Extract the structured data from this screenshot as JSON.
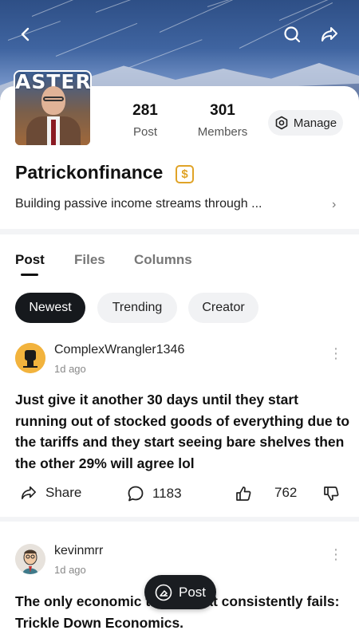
{
  "header": {
    "back_icon": "back-chevron-icon",
    "search_icon": "search-icon",
    "share_icon": "share-arrow-icon"
  },
  "profile": {
    "avatar_brand": "ASTER",
    "post_count": "281",
    "post_label": "Post",
    "member_count": "301",
    "member_label": "Members",
    "manage_label": "Manage",
    "name": "Patrickonfinance",
    "badge": "$",
    "bio": "Building passive income streams through ...",
    "bio_chevron": "›"
  },
  "tabs": [
    {
      "label": "Post",
      "active": true
    },
    {
      "label": "Files",
      "active": false
    },
    {
      "label": "Columns",
      "active": false
    }
  ],
  "filters": [
    {
      "label": "Newest",
      "active": true
    },
    {
      "label": "Trending",
      "active": false
    },
    {
      "label": "Creator",
      "active": false
    }
  ],
  "posts": [
    {
      "username": "ComplexWrangler1346",
      "time": "1d ago",
      "text": "Just give it another 30 days until they start running out of stocked goods of everything due to the tariffs and they start seeing bare shelves then the other 29% will agree lol",
      "share_label": "Share",
      "comments": "1183",
      "likes": "762"
    },
    {
      "username": "kevinmrr",
      "time": "1d ago",
      "text": "The only economic theory that consistently fails: Trickle Down Economics."
    }
  ],
  "fab": {
    "label": "Post"
  },
  "colors": {
    "accent_dark": "#16191d",
    "badge_gold": "#e0a327",
    "chip_bg": "#f1f2f4"
  }
}
